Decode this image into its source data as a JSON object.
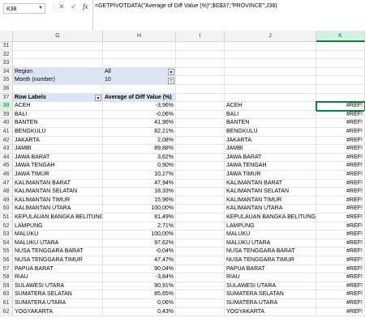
{
  "formula_bar": {
    "name_box": "K38",
    "formula": "=GETPIVOTDATA(\"Average of Diff Value (%)\";$G$37;\"PROVINCE\";J38)"
  },
  "columns": [
    "G",
    "H",
    "I",
    "J",
    "K"
  ],
  "rows": [
    31,
    32,
    33,
    34,
    35,
    36,
    37,
    38,
    39,
    40,
    41,
    42,
    43,
    44,
    45,
    46,
    47,
    48,
    49,
    50,
    51,
    52,
    53,
    54,
    55,
    56,
    57,
    58,
    59,
    60,
    61,
    62
  ],
  "pivot": {
    "filters": [
      {
        "label": "Region",
        "value": "All"
      },
      {
        "label": "Month (number)",
        "value": "10"
      }
    ],
    "header": {
      "row_labels": "Row Labels",
      "value_label": "Average of Diff Value (%)"
    },
    "data": [
      {
        "province": "ACEH",
        "value": "-3,96%"
      },
      {
        "province": "BALI",
        "value": "-0,06%"
      },
      {
        "province": "BANTEN",
        "value": "41,96%"
      },
      {
        "province": "BENGKULU",
        "value": "82,21%"
      },
      {
        "province": "JAKARTA",
        "value": "2,08%"
      },
      {
        "province": "JAMBI",
        "value": "89,88%"
      },
      {
        "province": "JAWA BARAT",
        "value": "3,62%"
      },
      {
        "province": "JAWA TENGAH",
        "value": "0,90%"
      },
      {
        "province": "JAWA TIMUR",
        "value": "10,27%"
      },
      {
        "province": "KALIMANTAN BARAT",
        "value": "47,94%"
      },
      {
        "province": "KALIMANTAN SELATAN",
        "value": "18,33%"
      },
      {
        "province": "KALIMANTAN TIMUR",
        "value": "15,96%"
      },
      {
        "province": "KALIMANTAN UTARA",
        "value": "100,00%"
      },
      {
        "province": "KEPULAUAN BANGKA BELITUNG",
        "value": "81,49%"
      },
      {
        "province": "LAMPUNG",
        "value": "2,71%"
      },
      {
        "province": "MALUKU",
        "value": "100,00%"
      },
      {
        "province": "MALUKU UTARA",
        "value": "97,62%"
      },
      {
        "province": "NUSA TENGGARA BARAT",
        "value": "-0,04%"
      },
      {
        "province": "NUSA TENGGARA TIMUR",
        "value": "47,47%"
      },
      {
        "province": "PAPUA BARAT",
        "value": "90,04%"
      },
      {
        "province": "RIAU",
        "value": "-3,84%"
      },
      {
        "province": "SULAWESI UTARA",
        "value": "90,91%"
      },
      {
        "province": "SUMATERA SELATAN",
        "value": "85,65%"
      },
      {
        "province": "SUMATERA UTARA",
        "value": "0,06%"
      },
      {
        "province": "YOGYAKARTA",
        "value": "0,43%"
      }
    ]
  },
  "lookup": {
    "provinces": [
      "ACEH",
      "BALI",
      "BANTEN",
      "BENGKULU",
      "JAKARTA",
      "JAMBI",
      "JAWA BARAT",
      "JAWA TENGAH",
      "JAWA TIMUR",
      "KALIMANTAN BARAT",
      "KALIMANTAN SELATAN",
      "KALIMANTAN TIMUR",
      "KALIMANTAN UTARA",
      "KEPULAUAN BANGKA BELITUNG",
      "LAMPUNG",
      "MALUKU",
      "MALUKU UTARA",
      "NUSA TENGGARA BARAT",
      "NUSA TENGGARA TIMUR",
      "PAPUA BARAT",
      "RIAU",
      "SULAWESI UTARA",
      "SUMATERA SELATAN",
      "SUMATERA UTARA",
      "YOGYAKARTA"
    ],
    "result": "#REF!"
  },
  "icons": {
    "cancel": "close-icon",
    "enter": "check-icon",
    "function": "fx-icon",
    "filter": "filter-icon",
    "dropdown": "chevron-down-icon"
  },
  "colors": {
    "accent": "#107c41",
    "pivot_fill": "#dbe4f4"
  }
}
